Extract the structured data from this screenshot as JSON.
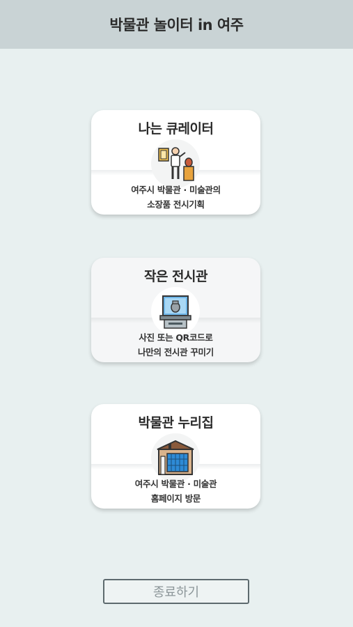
{
  "header": {
    "title": "박물관 놀이터 in 여주"
  },
  "cards": [
    {
      "title": "나는 큐레이터",
      "desc_line1": "여주시 박물관 · 미술관의",
      "desc_line2": "소장품 전시기획",
      "icon": "curator-icon"
    },
    {
      "title": "작은 전시관",
      "desc_line1": "사진 또는 QR코드로",
      "desc_line2": "나만의 전시관 꾸미기",
      "icon": "display-case-icon"
    },
    {
      "title": "박물관 누리집",
      "desc_line1": "여주시 박물관 · 미술관",
      "desc_line2": "홈페이지 방문",
      "icon": "museum-building-icon"
    }
  ],
  "footer": {
    "exit_label": "종료하기"
  }
}
